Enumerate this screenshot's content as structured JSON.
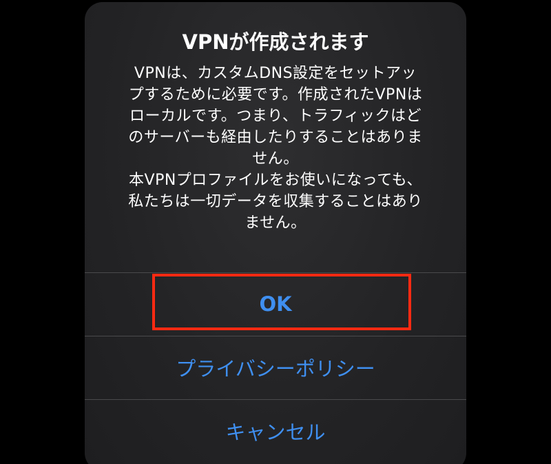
{
  "background": {
    "color": "#000000",
    "partial_text": "━━━━━"
  },
  "dialog": {
    "title": "VPNが作成されます",
    "message": "VPNは、カスタムDNS設定をセットアッ\nプするために必要です。作成されたVPNは\nローカルです。つまり、トラフィックはど\nのサーバーも経由したりすることはありま\nせん。\n本VPNプロファイルをお使いになっても、\n私たちは一切データを収集することはあり\nません。",
    "actions": {
      "ok": "OK",
      "privacy_policy": "プライバシーポリシー",
      "cancel": "キャンセル"
    },
    "action_color": "#3f8ff0"
  },
  "highlight": {
    "color": "#ff2a12",
    "target": "ok"
  }
}
